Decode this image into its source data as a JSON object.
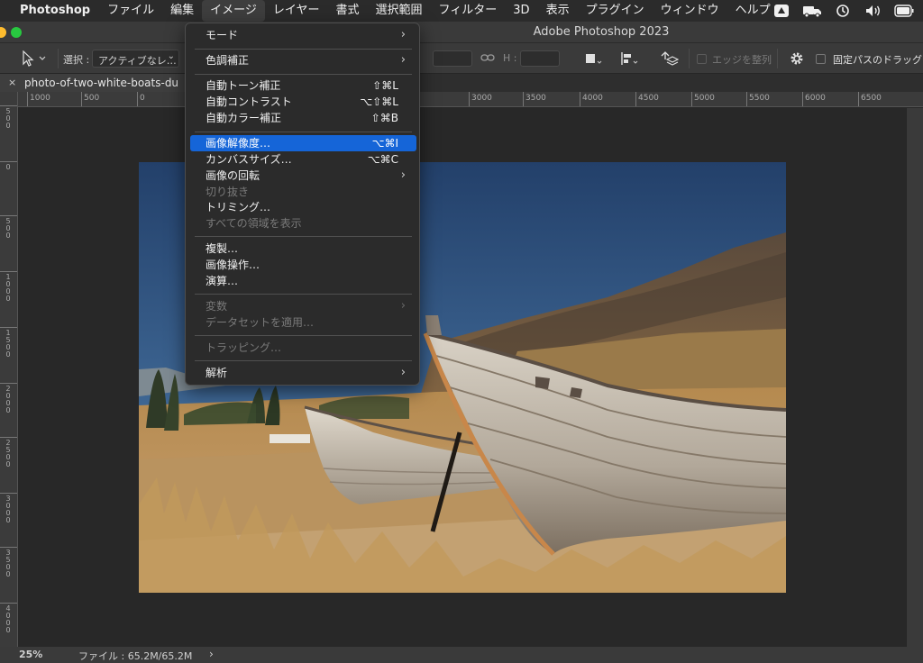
{
  "menubar": {
    "app": "Photoshop",
    "items": [
      "ファイル",
      "編集",
      "イメージ",
      "レイヤー",
      "書式",
      "選択範囲",
      "フィルター",
      "3D",
      "表示",
      "プラグイン",
      "ウィンドウ",
      "ヘルプ"
    ]
  },
  "window": {
    "title": "Adobe Photoshop 2023"
  },
  "options": {
    "select_label": "選択 :",
    "select_value": "アクティブなレ…",
    "h_label": "H :",
    "align_edges": "エッジを整列",
    "fixed_path_drag": "固定パスのドラッグ"
  },
  "document": {
    "tab_title": "photo-of-two-white-boats-du"
  },
  "rulers": {
    "top": [
      "1000",
      "500",
      "0",
      "3000",
      "3500",
      "4000",
      "4500",
      "5000",
      "5500",
      "6000",
      "6500"
    ],
    "left": [
      "500",
      "0",
      "500",
      "1000",
      "1500",
      "2000",
      "2500",
      "3000",
      "3500",
      "4000"
    ]
  },
  "status": {
    "zoom": "25%",
    "file_info": "ファイル : 65.2M/65.2M",
    "arrow": "›"
  },
  "image_menu": {
    "items": [
      {
        "label": "モード",
        "submenu": true
      },
      {
        "label": "色調補正",
        "submenu": true
      },
      {
        "label": "自動トーン補正",
        "shortcut": "⇧⌘L"
      },
      {
        "label": "自動コントラスト",
        "shortcut": "⌥⇧⌘L"
      },
      {
        "label": "自動カラー補正",
        "shortcut": "⇧⌘B"
      },
      {
        "label": "画像解像度…",
        "shortcut": "⌥⌘I",
        "highlighted": true
      },
      {
        "label": "カンバスサイズ…",
        "shortcut": "⌥⌘C"
      },
      {
        "label": "画像の回転",
        "submenu": true
      },
      {
        "label": "切り抜き",
        "disabled": true
      },
      {
        "label": "トリミング…"
      },
      {
        "label": "すべての領域を表示",
        "disabled": true
      },
      {
        "label": "複製…"
      },
      {
        "label": "画像操作…"
      },
      {
        "label": "演算…"
      },
      {
        "label": "変数",
        "submenu": true,
        "disabled": true
      },
      {
        "label": "データセットを適用…",
        "disabled": true
      },
      {
        "label": "トラッピング…",
        "disabled": true
      },
      {
        "label": "解析",
        "submenu": true
      }
    ],
    "highlight_color": "#1565d8"
  },
  "colors": {
    "traffic_red": "#ff5f57",
    "traffic_yellow": "#febc2e",
    "traffic_green": "#28c840"
  }
}
